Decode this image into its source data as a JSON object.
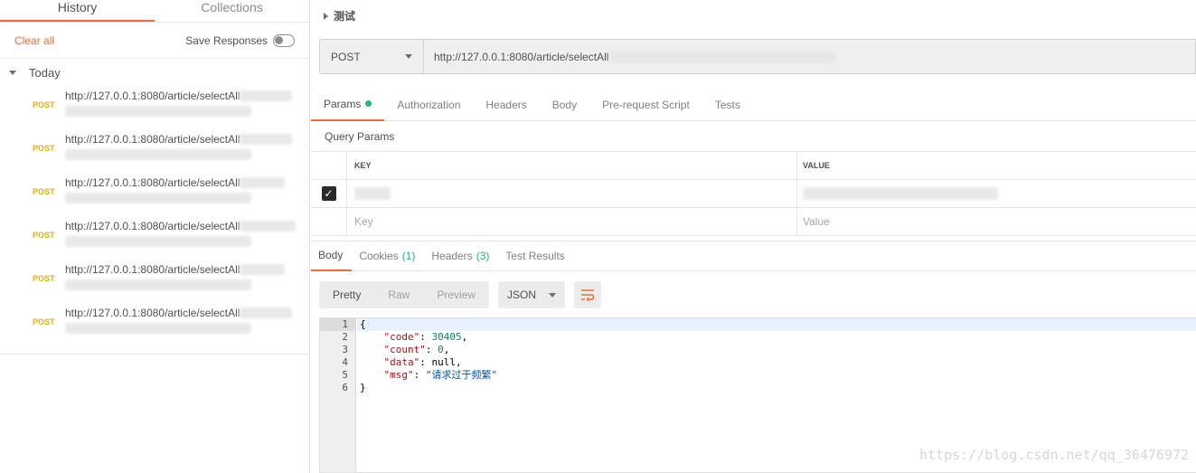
{
  "sidebar": {
    "tabs": [
      {
        "label": "History"
      },
      {
        "label": "Collections"
      }
    ],
    "clear_all": "Clear all",
    "save_responses": "Save Responses",
    "group_label": "Today",
    "history": [
      {
        "method": "POST",
        "url": "http://127.0.0.1:8080/article/selectAll"
      },
      {
        "method": "POST",
        "url": "http://127.0.0.1:8080/article/selectAll"
      },
      {
        "method": "POST",
        "url": "http://127.0.0.1:8080/article/selectAll"
      },
      {
        "method": "POST",
        "url": "http://127.0.0.1:8080/article/selectAll"
      },
      {
        "method": "POST",
        "url": "http://127.0.0.1:8080/article/selectAll"
      },
      {
        "method": "POST",
        "url": "http://127.0.0.1:8080/article/selectAll"
      }
    ]
  },
  "request": {
    "name": "测试",
    "method": "POST",
    "url": "http://127.0.0.1:8080/article/selectAll",
    "tabs": [
      "Params",
      "Authorization",
      "Headers",
      "Body",
      "Pre-request Script",
      "Tests"
    ],
    "query_params_title": "Query Params",
    "key_header": "KEY",
    "value_header": "VALUE",
    "key_placeholder": "Key",
    "value_placeholder": "Value"
  },
  "response": {
    "tabs": {
      "body": "Body",
      "cookies": "Cookies",
      "cookies_count": "(1)",
      "headers": "Headers",
      "headers_count": "(3)",
      "test_results": "Test Results"
    },
    "views": [
      "Pretty",
      "Raw",
      "Preview"
    ],
    "format": "JSON",
    "lines": [
      "1",
      "2",
      "3",
      "4",
      "5",
      "6"
    ],
    "json": {
      "open": "{",
      "code_key": "\"code\"",
      "code_val": "30405",
      "count_key": "\"count\"",
      "count_val": "0",
      "data_key": "\"data\"",
      "data_val": "null",
      "msg_key": "\"msg\"",
      "msg_val": "\"请求过于频繁\"",
      "close": "}"
    }
  },
  "watermark": "https://blog.csdn.net/qq_36476972",
  "colors": {
    "accent": "#f26b3a",
    "post": "#e8b100",
    "green": "#26b47f"
  }
}
